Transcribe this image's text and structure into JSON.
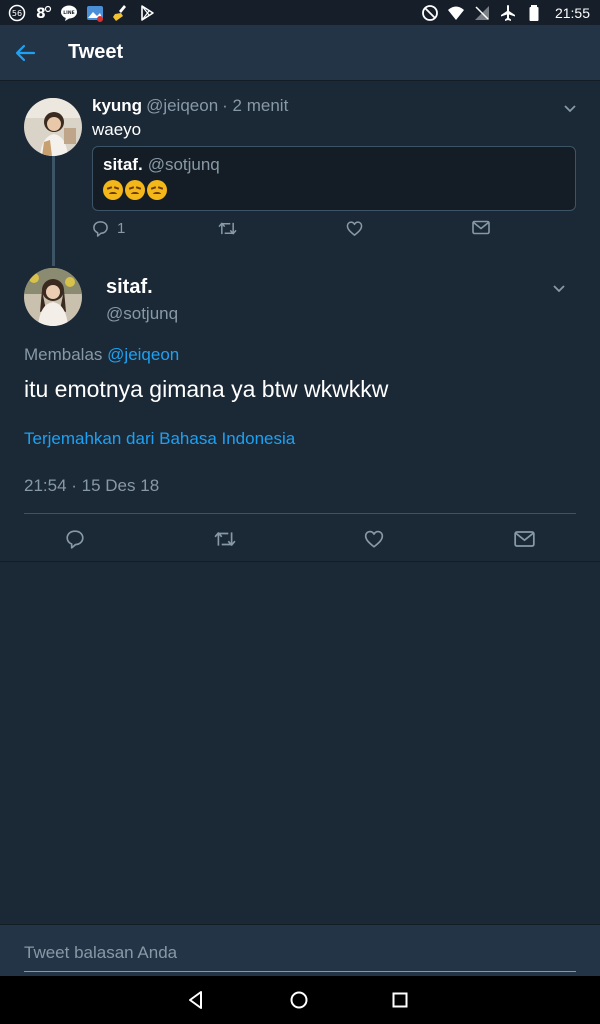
{
  "status_bar": {
    "time": "21:55",
    "left_icons": [
      "badge-56-icon",
      "settings-8-icon",
      "line-app-icon",
      "photo-icon",
      "clean-icon",
      "play-store-icon"
    ],
    "right_icons": [
      "do-not-disturb-icon",
      "wifi-icon",
      "no-signal-icon",
      "airplane-icon",
      "battery-icon"
    ]
  },
  "app_bar": {
    "title": "Tweet"
  },
  "parent_tweet": {
    "name": "kyung",
    "handle": "@jeiqeon",
    "time": "· 2 menit",
    "text": "waeyo",
    "quote": {
      "name": "sitaf.",
      "handle": "@sotjunq",
      "emoji_count": 3
    },
    "reply_count": "1"
  },
  "main_tweet": {
    "name": "sitaf.",
    "handle": "@sotjunq",
    "reply_prefix": "Membalas",
    "reply_to": "@jeiqeon",
    "text": "itu emotnya gimana ya btw wkwkkw",
    "translate": "Terjemahkan dari Bahasa Indonesia",
    "timestamp": "21:54 · 15 Des 18"
  },
  "reply_box": {
    "placeholder": "Tweet balasan Anda"
  },
  "colors": {
    "background": "#1b2836",
    "bar": "#243447",
    "accent": "#1da1f2",
    "muted": "#8899a6"
  }
}
